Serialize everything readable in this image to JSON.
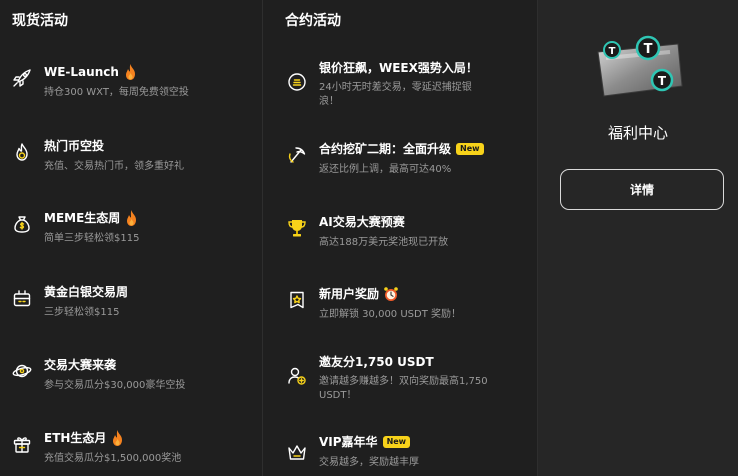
{
  "spot": {
    "title": "现货活动",
    "items": [
      {
        "icon": "rocket-icon",
        "title": "WE-Launch",
        "hot": true,
        "desc": "持仓300 WXT，每周免费领空投"
      },
      {
        "icon": "coin-flame-icon",
        "title": "热门币空投",
        "hot": false,
        "desc": "充值、交易热门币，领多重好礼"
      },
      {
        "icon": "money-bag-icon",
        "title": "MEME生态周",
        "hot": true,
        "desc": "简单三步轻松领$115"
      },
      {
        "icon": "gift-box-icon",
        "title": "黄金白银交易周",
        "hot": false,
        "desc": "三步轻松领$115"
      },
      {
        "icon": "planet-icon",
        "title": "交易大赛来袭",
        "hot": false,
        "desc": "参与交易瓜分$30,000豪华空投"
      },
      {
        "icon": "gift-icon",
        "title": "ETH生态月",
        "hot": true,
        "desc": "充值交易瓜分$1,500,000奖池"
      }
    ]
  },
  "futures": {
    "title": "合约活动",
    "items": [
      {
        "icon": "coin-stack-icon",
        "title": "银价狂飙，WEEX强势入局！",
        "desc": "24小时无时差交易，零延迟捕捉银浪！"
      },
      {
        "icon": "pickaxe-icon",
        "title": "合约挖矿二期：全面升级",
        "badge": "New",
        "desc": "返还比例上调，最高可达40%"
      },
      {
        "icon": "trophy-icon",
        "title": "AI交易大赛预赛",
        "desc": "高达188万美元奖池现已开放"
      },
      {
        "icon": "reward-card-icon",
        "title": "新用户奖励",
        "desc": "立即解锁 30,000 USDT 奖励！"
      },
      {
        "icon": "invite-user-icon",
        "title": "邀友分1,750 USDT",
        "desc": "邀请越多赚越多！双向奖励最高1,750 USDT！"
      },
      {
        "icon": "crown-icon",
        "title": "VIP嘉年华",
        "badge": "New",
        "desc": "交易越多，奖励越丰厚"
      }
    ]
  },
  "welfare": {
    "title": "福利中心",
    "button": "详情",
    "image": "tether-token-illustration"
  },
  "colors": {
    "background": "#1f1f1f",
    "accent": "#f7d21a",
    "fire": "#f5821f",
    "muted_text": "#9a9a9a"
  }
}
